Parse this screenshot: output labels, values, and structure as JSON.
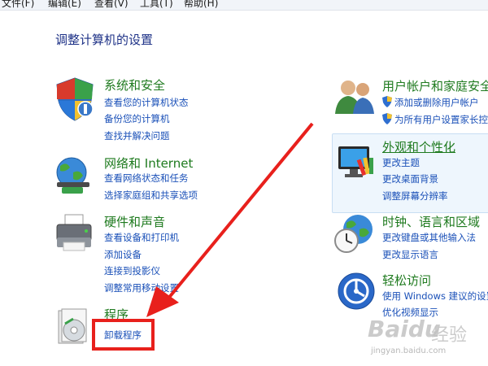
{
  "menu": [
    "文件(F)",
    "编辑(E)",
    "查看(V)",
    "工具(T)",
    "帮助(H)"
  ],
  "title": "调整计算机的设置",
  "left_categories": [
    {
      "title": "系统和安全",
      "links": [
        "查看您的计算机状态",
        "备份您的计算机",
        "查找并解决问题"
      ]
    },
    {
      "title": "网络和 Internet",
      "links": [
        "查看网络状态和任务",
        "选择家庭组和共享选项"
      ]
    },
    {
      "title": "硬件和声音",
      "links": [
        "查看设备和打印机",
        "添加设备",
        "连接到投影仪",
        "调整常用移动设置"
      ]
    },
    {
      "title": "程序",
      "links": [
        "卸载程序"
      ]
    }
  ],
  "right_categories": [
    {
      "title": "用户帐户和家庭安全",
      "links": [
        "添加或删除用户帐户",
        "为所有用户设置家长控制"
      ]
    },
    {
      "title": "外观和个性化",
      "links": [
        "更改主题",
        "更改桌面背景",
        "调整屏幕分辨率"
      ]
    },
    {
      "title": "时钟、语言和区域",
      "links": [
        "更改键盘或其他输入法",
        "更改显示语言"
      ]
    },
    {
      "title": "轻松访问",
      "links": [
        "使用 Windows 建议的设置",
        "优化视频显示"
      ]
    }
  ],
  "watermark": {
    "logo": "Baidu",
    "jingyan": "经验",
    "url": "jingyan.baidu.com"
  },
  "colors": {
    "title": "#1e3287",
    "category": "#1e7a1e",
    "link": "#1a50b8",
    "arrow": "#e8201c",
    "highlight": "#eef6fd"
  }
}
